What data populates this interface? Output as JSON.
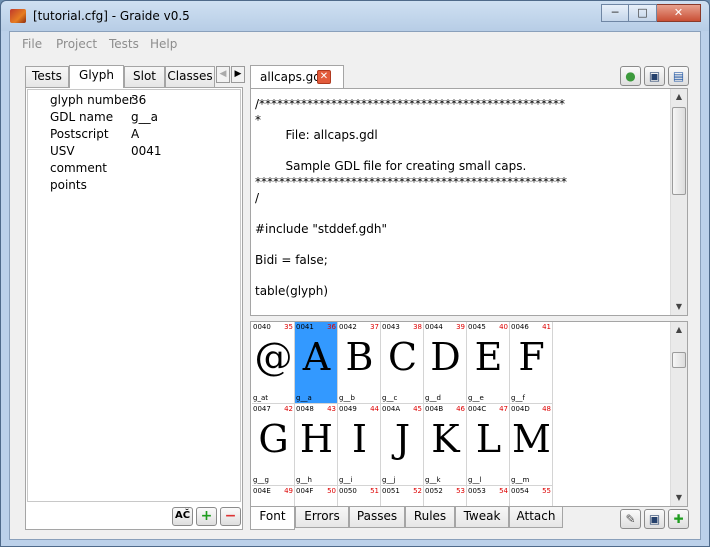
{
  "window": {
    "title": "[tutorial.cfg] - Graide v0.5",
    "buttons": {
      "minimize": "─",
      "maximize": "□",
      "close": "✕"
    }
  },
  "menu": [
    "File",
    "Project",
    "Tests",
    "Help"
  ],
  "left_tabs": [
    {
      "label": "Tests",
      "active": false
    },
    {
      "label": "Glyph",
      "active": true
    },
    {
      "label": "Slot",
      "active": false
    },
    {
      "label": "Classes",
      "active": false
    }
  ],
  "glyph_properties": [
    {
      "name": "glyph number",
      "value": "36"
    },
    {
      "name": "GDL name",
      "value": "g__a"
    },
    {
      "name": "Postscript",
      "value": "A"
    },
    {
      "name": "USV",
      "value": "0041"
    },
    {
      "name": "comment",
      "value": ""
    },
    {
      "name": "points",
      "value": ""
    }
  ],
  "left_buttons": {
    "spell_label": "AČ",
    "add_label": "+",
    "remove_label": "−"
  },
  "editor": {
    "tab_label": "allcaps.gdl",
    "tab_close": "✕",
    "code_lines": [
      "/***************************************************",
      "*",
      "        File: allcaps.gdl",
      "",
      "        Sample GDL file for creating small caps.",
      "****************************************************",
      "/",
      "",
      "#include \"stddef.gdh\"",
      "",
      "Bidi = false;",
      "",
      "table(glyph)"
    ]
  },
  "glyph_grid": [
    {
      "hex": "0040",
      "id": "35",
      "char": "@",
      "name": "g_at",
      "selected": false
    },
    {
      "hex": "0041",
      "id": "36",
      "char": "A",
      "name": "g__a",
      "selected": true
    },
    {
      "hex": "0042",
      "id": "37",
      "char": "B",
      "name": "g__b",
      "selected": false
    },
    {
      "hex": "0043",
      "id": "38",
      "char": "C",
      "name": "g__c",
      "selected": false
    },
    {
      "hex": "0044",
      "id": "39",
      "char": "D",
      "name": "g__d",
      "selected": false
    },
    {
      "hex": "0045",
      "id": "40",
      "char": "E",
      "name": "g__e",
      "selected": false
    },
    {
      "hex": "0046",
      "id": "41",
      "char": "F",
      "name": "g__f",
      "selected": false
    },
    {
      "hex": "0047",
      "id": "42",
      "char": "G",
      "name": "g__g",
      "selected": false
    },
    {
      "hex": "0048",
      "id": "43",
      "char": "H",
      "name": "g__h",
      "selected": false
    },
    {
      "hex": "0049",
      "id": "44",
      "char": "I",
      "name": "g__i",
      "selected": false
    },
    {
      "hex": "004A",
      "id": "45",
      "char": "J",
      "name": "g__j",
      "selected": false
    },
    {
      "hex": "004B",
      "id": "46",
      "char": "K",
      "name": "g__k",
      "selected": false
    },
    {
      "hex": "004C",
      "id": "47",
      "char": "L",
      "name": "g__l",
      "selected": false
    },
    {
      "hex": "004D",
      "id": "48",
      "char": "M",
      "name": "g__m",
      "selected": false
    },
    {
      "hex": "004E",
      "id": "49",
      "char": "",
      "name": "",
      "selected": false
    },
    {
      "hex": "004F",
      "id": "50",
      "char": "",
      "name": "",
      "selected": false
    },
    {
      "hex": "0050",
      "id": "51",
      "char": "",
      "name": "",
      "selected": false
    },
    {
      "hex": "0051",
      "id": "52",
      "char": "",
      "name": "",
      "selected": false
    },
    {
      "hex": "0052",
      "id": "53",
      "char": "",
      "name": "",
      "selected": false
    },
    {
      "hex": "0053",
      "id": "54",
      "char": "",
      "name": "",
      "selected": false
    },
    {
      "hex": "0054",
      "id": "55",
      "char": "",
      "name": "",
      "selected": false
    }
  ],
  "bottom_tabs": [
    {
      "label": "Font",
      "active": true
    },
    {
      "label": "Errors",
      "active": false
    },
    {
      "label": "Passes",
      "active": false
    },
    {
      "label": "Rules",
      "active": false
    },
    {
      "label": "Tweak",
      "active": false
    },
    {
      "label": "Attach",
      "active": false
    }
  ],
  "colors": {
    "selection": "#3399ff",
    "glyph_id": "#dd0000",
    "tab_close": "#e25b3b"
  }
}
